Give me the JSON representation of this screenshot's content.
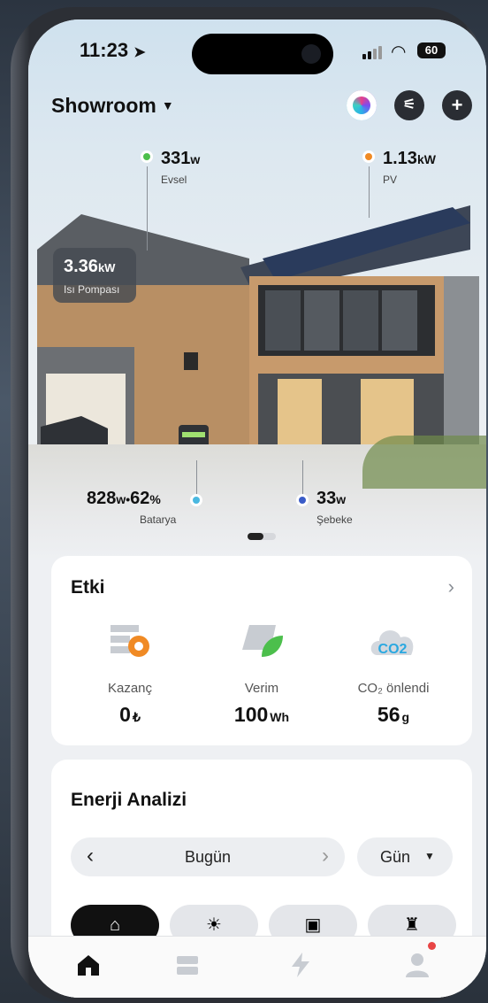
{
  "status_bar": {
    "time": "11:23",
    "battery": "60"
  },
  "header": {
    "location": "Showroom"
  },
  "hero": {
    "home": {
      "value": "331",
      "unit": "w",
      "label": "Evsel",
      "color": "#4cbf4c"
    },
    "pv": {
      "value": "1.13",
      "unit": "kW",
      "label": "PV",
      "color": "#f08a24"
    },
    "heat_pump": {
      "value": "3.36",
      "unit": "kW",
      "label": "Isı Pompası"
    },
    "battery": {
      "power": "828",
      "power_unit": "w",
      "sep": "•",
      "percent": "62",
      "percent_unit": "%",
      "label": "Batarya",
      "color": "#4ab8e0"
    },
    "grid": {
      "value": "33",
      "unit": "w",
      "label": "Şebeke",
      "color": "#3a5cc8"
    }
  },
  "impact": {
    "title": "Etki",
    "metrics": [
      {
        "label": "Kazanç",
        "value": "0",
        "unit": "₺",
        "icon": "savings-icon"
      },
      {
        "label": "Verim",
        "value": "100",
        "unit": "Wh",
        "icon": "solar-leaf-icon"
      },
      {
        "label": "CO₂ önlendi",
        "value": "56",
        "unit": "g",
        "icon": "co2-cloud-icon"
      }
    ]
  },
  "energy": {
    "title": "Enerji Analizi",
    "period": "Bugün",
    "granularity": "Gün",
    "tabs": [
      "home-energy-icon",
      "sun-icon",
      "battery-icon",
      "grid-tower-icon"
    ]
  },
  "nav": [
    "home-icon",
    "devices-icon",
    "energy-icon",
    "profile-icon"
  ],
  "co2_icon_text": "CO2"
}
